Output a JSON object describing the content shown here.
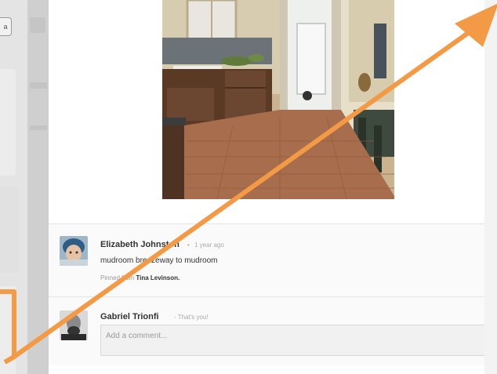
{
  "left_panel": {
    "tab_label": "a"
  },
  "photo": {
    "alt": "mudroom photo"
  },
  "comments": [
    {
      "author": "Elizabeth Johnston",
      "separator": "•",
      "time": "1 year ago",
      "text": "mudroom breezeway to mudroom",
      "source_prefix": "Pinned from",
      "source_name": "Tina Levinson."
    }
  ],
  "composer": {
    "author": "Gabriel Trionfi",
    "note": "- That's you!",
    "placeholder": "Add a comment..."
  },
  "overlay": {
    "arrow_color": "#f29a46"
  }
}
